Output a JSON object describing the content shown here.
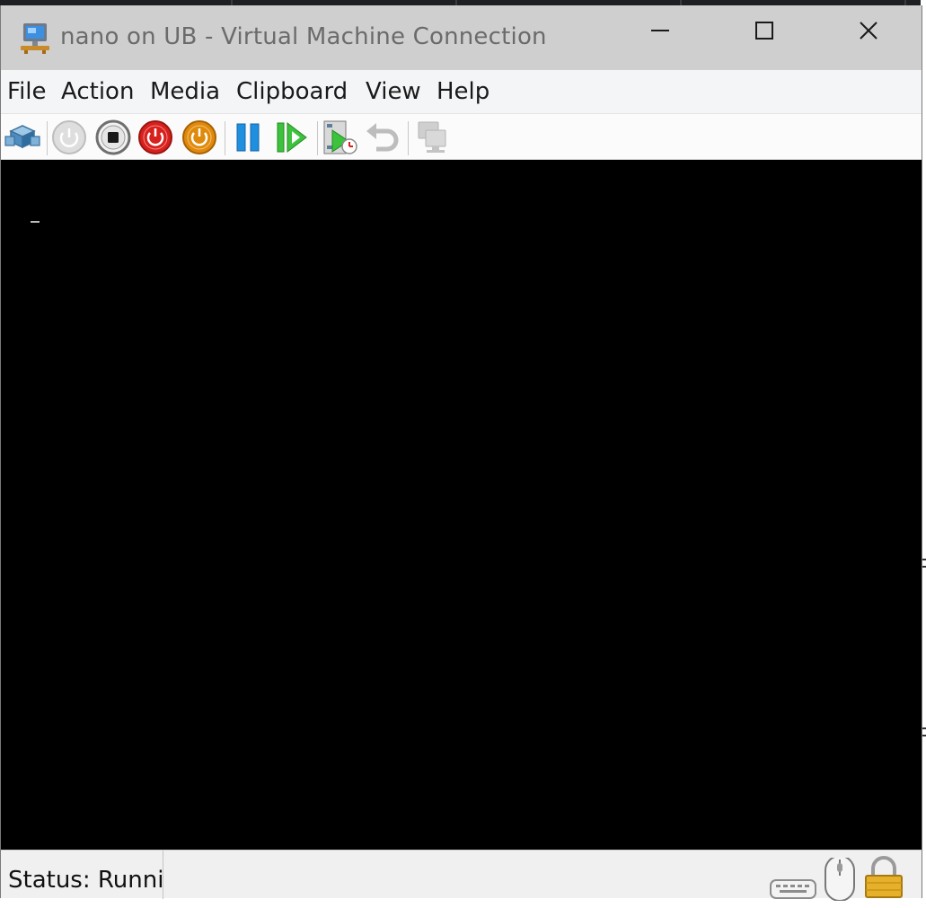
{
  "window": {
    "title": "nano on UB - Virtual Machine Connection",
    "controls": {
      "minimize": "minimize",
      "maximize": "maximize",
      "close": "close"
    }
  },
  "menu": {
    "items": [
      "File",
      "Action",
      "Media",
      "Clipboard",
      "View",
      "Help"
    ]
  },
  "toolbar": {
    "buttons": [
      {
        "name": "ctrl-alt-del",
        "icon": "ctrl-alt-del-icon",
        "enabled": true
      },
      {
        "name": "start",
        "icon": "power-start-icon",
        "enabled": false
      },
      {
        "name": "turn-off",
        "icon": "stop-icon",
        "enabled": true
      },
      {
        "name": "shut-down",
        "icon": "power-red-icon",
        "enabled": true
      },
      {
        "name": "save",
        "icon": "power-orange-icon",
        "enabled": true
      },
      {
        "name": "pause",
        "icon": "pause-icon",
        "enabled": true
      },
      {
        "name": "reset",
        "icon": "reset-icon",
        "enabled": true
      },
      {
        "name": "checkpoint",
        "icon": "checkpoint-icon",
        "enabled": true
      },
      {
        "name": "revert",
        "icon": "revert-icon",
        "enabled": false
      },
      {
        "name": "enhanced-session",
        "icon": "enhanced-session-icon",
        "enabled": false
      }
    ]
  },
  "screen": {
    "background": "#000000",
    "cursor": "_"
  },
  "status": {
    "text": "Status: Runni",
    "icons": [
      "keyboard-icon",
      "mouse-icon",
      "lock-icon"
    ]
  },
  "colors": {
    "titlebar": "#cfcfcf",
    "title_text": "#6b6b6b",
    "menubar": "#f4f5f7",
    "power_red": "#d8201d",
    "power_orange": "#e08a0b",
    "pause_blue": "#1f8fe0",
    "reset_green": "#3cc23c"
  }
}
